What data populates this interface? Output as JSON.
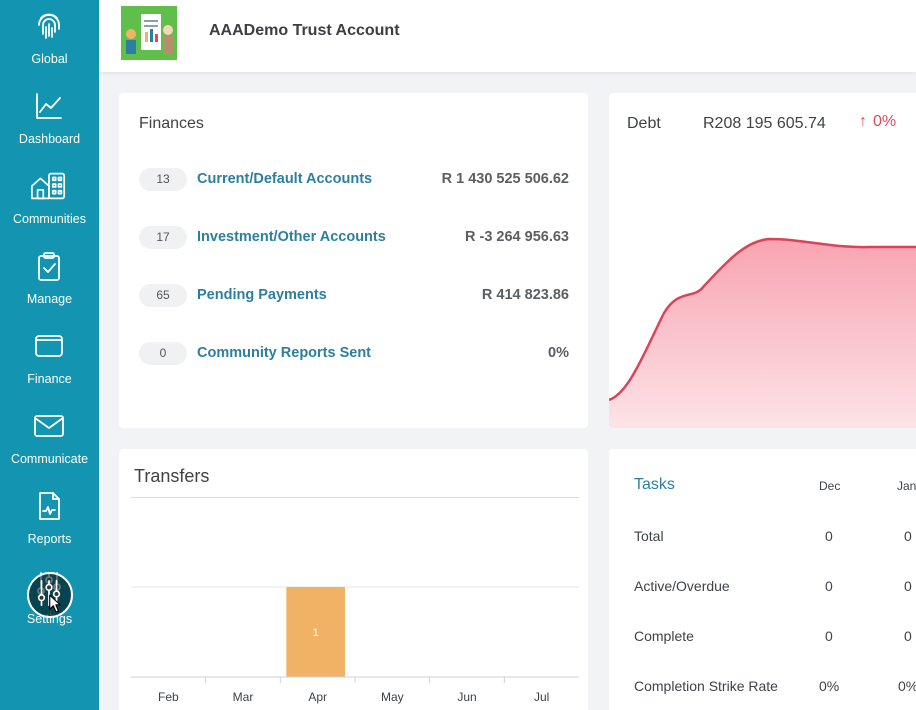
{
  "sidebar": {
    "items": [
      {
        "label": "Global",
        "icon": "fingerprint-icon"
      },
      {
        "label": "Dashboard",
        "icon": "line-chart-icon"
      },
      {
        "label": "Communities",
        "icon": "community-icon"
      },
      {
        "label": "Manage",
        "icon": "clipboard-check-icon"
      },
      {
        "label": "Finance",
        "icon": "wallet-icon"
      },
      {
        "label": "Communicate",
        "icon": "envelope-icon"
      },
      {
        "label": "Reports",
        "icon": "report-icon"
      },
      {
        "label": "Settings",
        "icon": "sliders-icon"
      }
    ],
    "color": "#1395b1"
  },
  "header": {
    "title": "AAADemo Trust Account"
  },
  "finances": {
    "title": "Finances",
    "rows": [
      {
        "count": "13",
        "name": "Current/Default Accounts",
        "value": "R 1 430 525 506.62"
      },
      {
        "count": "17",
        "name": "Investment/Other Accounts",
        "value": "R -3 264 956.63"
      },
      {
        "count": "65",
        "name": "Pending Payments",
        "value": "R 414 823.86"
      },
      {
        "count": "0",
        "name": "Community Reports Sent",
        "value": "0%"
      }
    ]
  },
  "debt": {
    "label": "Debt",
    "amount": "R208 195 605.74",
    "change": "0%",
    "color": "#d9445a"
  },
  "transfers": {
    "title": "Transfers",
    "chart_data": {
      "type": "bar",
      "categories": [
        "Feb",
        "Mar",
        "Apr",
        "May",
        "Jun",
        "Jul"
      ],
      "values": [
        0,
        0,
        1,
        0,
        0,
        0
      ],
      "data_labels": [
        "",
        "",
        "1",
        "",
        "",
        ""
      ],
      "ylim": [
        0,
        1
      ],
      "grid": true,
      "bar_color": "#f2b266"
    }
  },
  "tasks": {
    "title": "Tasks",
    "columns": [
      "Dec",
      "Jan"
    ],
    "rows": [
      {
        "label": "Total",
        "values": [
          "0",
          "0"
        ]
      },
      {
        "label": "Active/Overdue",
        "values": [
          "0",
          "0"
        ]
      },
      {
        "label": "Complete",
        "values": [
          "0",
          "0"
        ]
      },
      {
        "label": "Completion Strike Rate",
        "values": [
          "0%",
          "0%"
        ]
      }
    ]
  }
}
